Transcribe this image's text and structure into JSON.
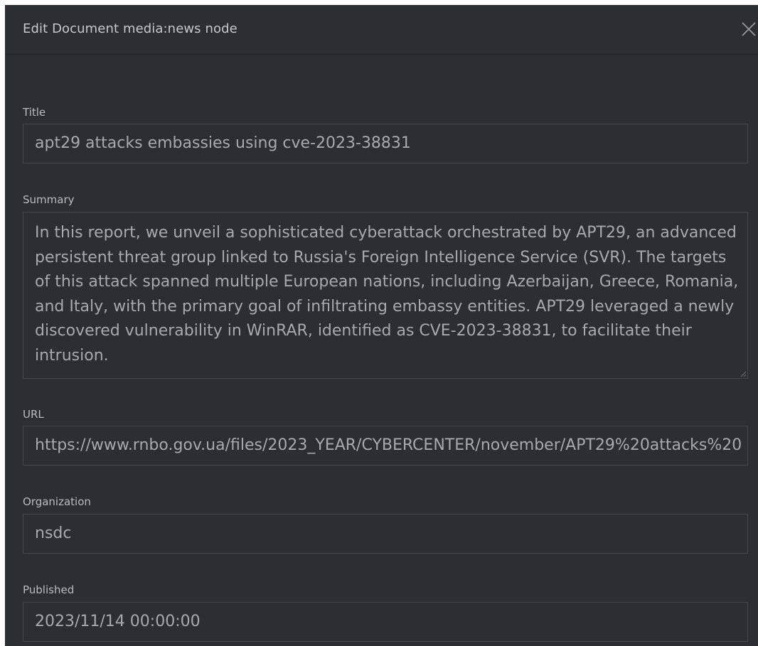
{
  "dialog": {
    "title": "Edit Document media:news node",
    "close_icon": "close-icon"
  },
  "fields": {
    "title": {
      "label": "Title",
      "value": "apt29 attacks embassies using cve-2023-38831"
    },
    "summary": {
      "label": "Summary",
      "value": "In this report, we unveil a sophisticated cyberattack orchestrated by APT29, an advanced persistent threat group linked to Russia's Foreign Intelligence Service (SVR). The targets of this attack spanned multiple European nations, including Azerbaijan, Greece, Romania, and Italy, with the primary goal of infiltrating embassy entities. APT29 leveraged a newly discovered vulnerability in WinRAR, identified as CVE-2023-38831, to facilitate their intrusion."
    },
    "url": {
      "label": "URL",
      "value": "https://www.rnbo.gov.ua/files/2023_YEAR/CYBERCENTER/november/APT29%20attacks%20"
    },
    "organization": {
      "label": "Organization",
      "value": "nsdc"
    },
    "published": {
      "label": "Published",
      "value": "2023/11/14 00:00:00"
    }
  },
  "colors": {
    "background": "#2b2e32",
    "border": "#43474c",
    "text": "#a6aaae"
  }
}
